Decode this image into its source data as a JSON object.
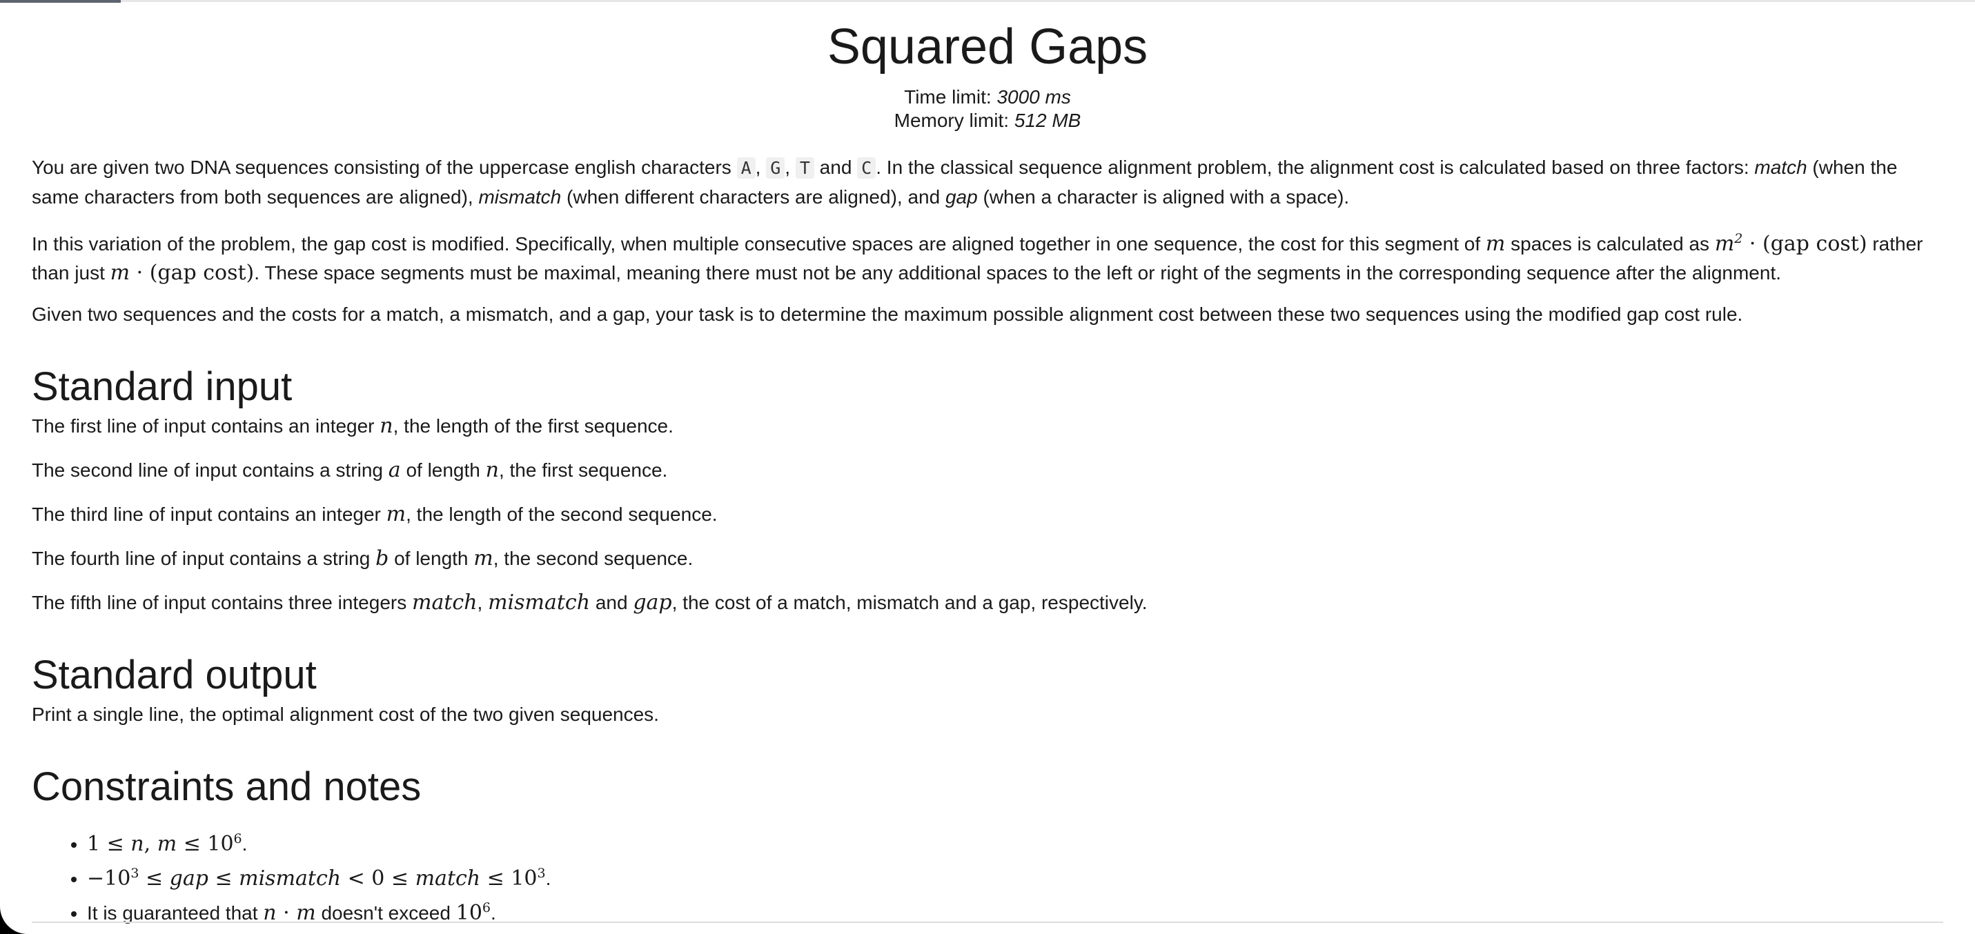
{
  "problem": {
    "title": "Squared Gaps",
    "time_limit_label": "Time limit:",
    "time_limit_value": "3000 ms",
    "memory_limit_label": "Memory limit:",
    "memory_limit_value": "512 MB"
  },
  "statement": {
    "p1_a": "You are given two DNA sequences consisting of the uppercase english characters",
    "chars": [
      "A",
      "G",
      "T",
      "C"
    ],
    "p1_and": "and",
    "p1_b": ". In the classical sequence alignment problem, the alignment cost is calculated based on three factors:",
    "term_match": "match",
    "p1_c": "(when the same characters from both sequences are aligned),",
    "term_mismatch": "mismatch",
    "p1_d": "(when different characters are aligned), and",
    "term_gap": "gap",
    "p1_e": "(when a character is aligned with a space).",
    "p2_a": "In this variation of the problem, the gap cost is modified. Specifically, when multiple consecutive spaces are aligned together in one sequence, the cost for this segment of",
    "p2_b": "spaces is calculated as",
    "p2_c": "rather than just",
    "p2_d": ". These space segments must be maximal, meaning there must not be any additional spaces to the left or right of the segments in the corresponding sequence after the alignment.",
    "gap_cost_text": "(gap cost)",
    "p3": "Given two sequences and the costs for a match, a mismatch, and a gap, your task is to determine the maximum possible alignment cost between these two sequences using the modified gap cost rule."
  },
  "input_section": {
    "heading": "Standard input",
    "l1_a": "The first line of input contains an integer",
    "l1_b": ", the length of the first sequence.",
    "l2_a": "The second line of input contains a string",
    "l2_b": "of length",
    "l2_c": ", the first sequence.",
    "l3_a": "The third line of input contains an integer",
    "l3_b": ", the length of the second sequence.",
    "l4_a": "The fourth line of input contains a string",
    "l4_b": "of length",
    "l4_c": ", the second sequence.",
    "l5_a": "The fifth line of input contains three integers",
    "l5_and": "and",
    "l5_b": ", the cost of a match, mismatch and a gap, respectively."
  },
  "output_section": {
    "heading": "Standard output",
    "text": "Print a single line, the optimal alignment cost of the two given sequences."
  },
  "constraints_section": {
    "heading": "Constraints and notes",
    "c3_a": "It is guaranteed that",
    "c3_b": "doesn't exceed"
  },
  "symbols": {
    "n": "n",
    "m": "m",
    "a": "a",
    "b": "b",
    "match": "match",
    "mismatch": "mismatch",
    "gap": "gap"
  }
}
